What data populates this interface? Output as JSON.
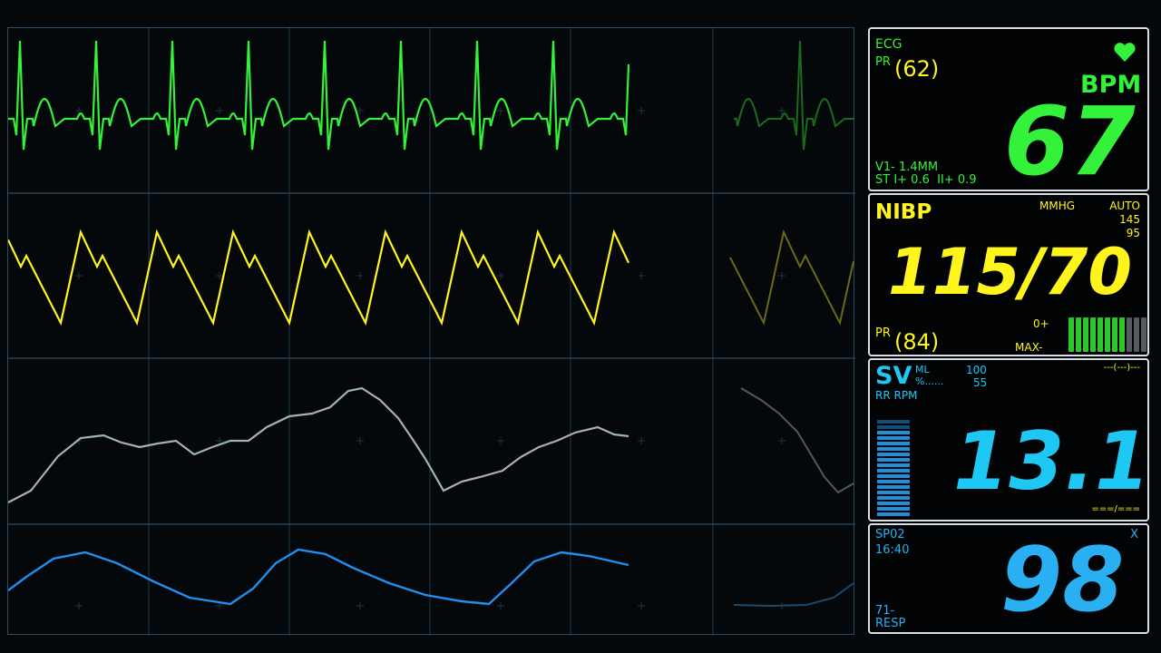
{
  "colors": {
    "ecg": "#34f23a",
    "nibp": "#fff51c",
    "sv": "#1ec8f5",
    "spo2": "#2ab0f2",
    "resp_wave": "#9fb3b8",
    "pleth_wave": "#1f8ff0",
    "grid": "#1d3a4e",
    "panel_border": "#d9dfe4",
    "bar_off": "#555a5e"
  },
  "ecg": {
    "label": "ECG",
    "pr_label": "PR",
    "pr_value": "(62)",
    "heart_icon": "heart-icon",
    "bpm_label": "BPM",
    "hr_value": "67",
    "st_line1": "V1- 1.4MM",
    "st_line2": "ST I+ 0.6  II+ 0.9"
  },
  "nibp": {
    "label": "NIBP",
    "unit": "MMHG",
    "mode": "AUTO",
    "limit_high": "145",
    "limit_low": "95",
    "value": "115/70",
    "pr_label": "PR",
    "pr_value": "(84)",
    "scale_top": "0+",
    "scale_bottom": "MAX-",
    "bar_level": 0.7
  },
  "sv": {
    "label": "SV",
    "unit_ml": "ML",
    "unit_pct": "%......",
    "sub_label": "RR RPM",
    "limit_high": "100",
    "limit_low": "55",
    "top_right": "---(---)---",
    "value": "13.1",
    "bottom_right": "===/==="
  },
  "spo2": {
    "label": "SP02",
    "time": "16:40",
    "close": "X",
    "value": "98",
    "bottom_line1": "71-",
    "bottom_line2": "RESP"
  }
}
